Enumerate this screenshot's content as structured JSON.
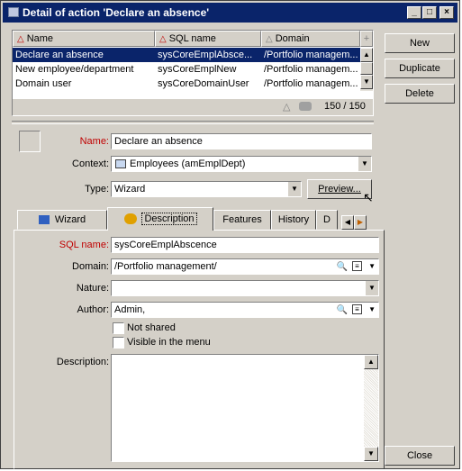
{
  "window": {
    "title": "Detail of action 'Declare an absence'"
  },
  "list": {
    "columns": [
      "Name",
      "SQL name",
      "Domain"
    ],
    "rows": [
      {
        "name": "Declare an absence",
        "sql": "sysCoreEmplAbsce...",
        "domain": "/Portfolio managem..."
      },
      {
        "name": "New employee/department",
        "sql": "sysCoreEmplNew",
        "domain": "/Portfolio managem..."
      },
      {
        "name": "Domain user",
        "sql": "sysCoreDomainUser",
        "domain": "/Portfolio managem..."
      }
    ],
    "count": "150 / 150"
  },
  "buttons": {
    "new": "New",
    "duplicate": "Duplicate",
    "delete": "Delete",
    "close": "Close",
    "preview": "Preview..."
  },
  "form": {
    "name_label": "Name:",
    "name_value": "Declare an absence",
    "context_label": "Context:",
    "context_value": "Employees (amEmplDept)",
    "type_label": "Type:",
    "type_value": "Wizard"
  },
  "tabs": [
    "Wizard",
    "Description",
    "Features",
    "History",
    "D"
  ],
  "desc": {
    "sql_label": "SQL name:",
    "sql_value": "sysCoreEmplAbscence",
    "domain_label": "Domain:",
    "domain_value": "/Portfolio management/",
    "nature_label": "Nature:",
    "nature_value": "",
    "author_label": "Author:",
    "author_value": "Admin,",
    "not_shared": "Not shared",
    "visible_menu": "Visible in the menu",
    "description_label": "Description:"
  },
  "colors": {
    "titlebar": "#0a246a",
    "selection": "#0a246a",
    "required": "#c00000",
    "face": "#d4d0c8"
  }
}
